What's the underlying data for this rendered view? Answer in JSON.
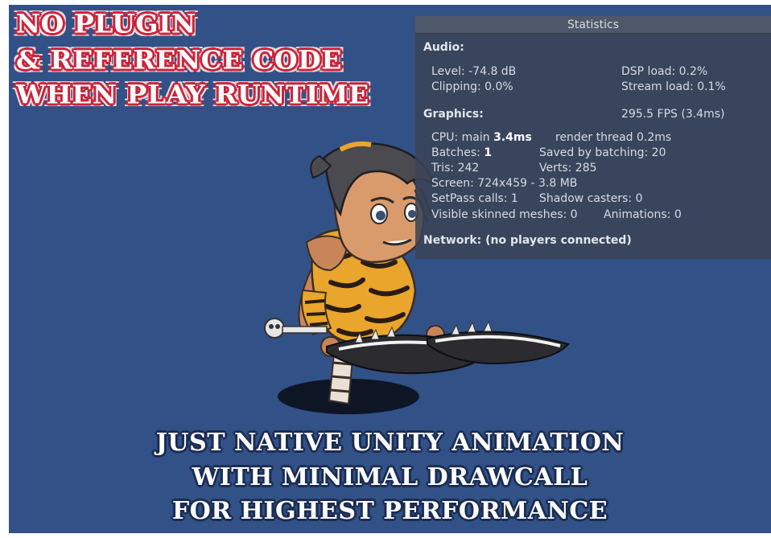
{
  "headline": {
    "line1": "NO PLUGIN",
    "line2": "& REFERENCE CODE",
    "line3": "WHEN  PLAY RUNTIME"
  },
  "caption": {
    "line1": "JUST NATIVE UNITY ANIMATION",
    "line2": "WITH MINIMAL DRAWCALL",
    "line3": "FOR HIGHEST PERFORMANCE"
  },
  "statistics": {
    "title": "Statistics",
    "audio": {
      "heading": "Audio:",
      "level": "Level: -74.8 dB",
      "dsp_load": "DSP load: 0.2%",
      "clipping": "Clipping: 0.0%",
      "stream_load": "Stream load: 0.1%"
    },
    "graphics": {
      "heading": "Graphics:",
      "fps": "295.5 FPS (3.4ms)",
      "cpu_label": "CPU: main ",
      "cpu_main": "3.4ms",
      "render_thread": "render thread 0.2ms",
      "batches_label": "Batches: ",
      "batches": "1",
      "saved_by_batching": "Saved by batching: 20",
      "tris": "Tris: 242",
      "verts": "Verts: 285",
      "screen": "Screen: 724x459 - 3.8 MB",
      "setpass": "SetPass calls: 1",
      "shadow_casters": "Shadow casters: 0",
      "visible_skinned": "Visible skinned meshes: 0",
      "animations": "Animations: 0"
    },
    "network": "Network: (no players connected)"
  },
  "colors": {
    "background": "#325187",
    "headline_outline": "#c8243a",
    "panel": "#3a4456"
  }
}
